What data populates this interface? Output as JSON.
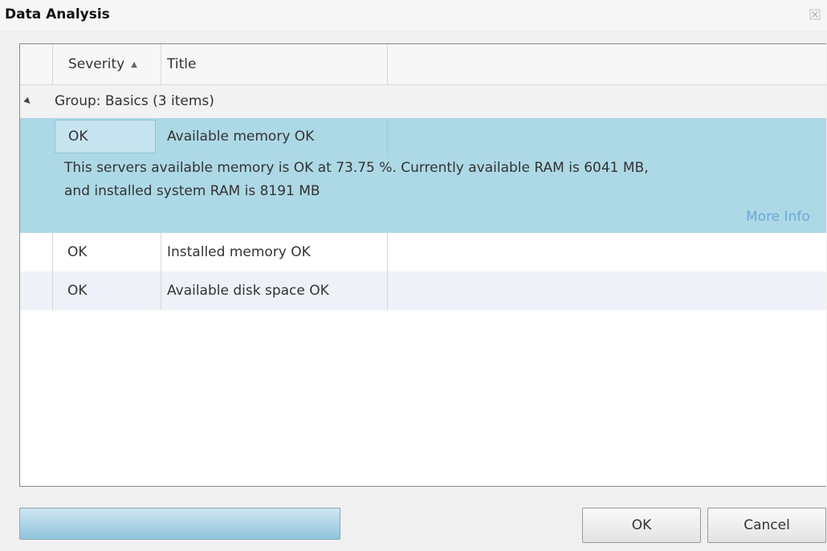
{
  "window": {
    "title": "Data Analysis"
  },
  "grid": {
    "columns": [
      {
        "label": "Severity",
        "sort": "ascending"
      },
      {
        "label": "Title"
      }
    ],
    "group": {
      "label": "Group: Basics (3 items)",
      "expanded": true
    },
    "selected_row": {
      "severity": "OK",
      "title": "Available memory OK",
      "detail_line1": "This servers available memory is OK at 73.75 %. Currently available RAM is 6041 MB,",
      "detail_line2": "and installed system RAM is 8191 MB",
      "more_info_label": "More Info"
    },
    "rows": [
      {
        "severity": "OK",
        "title": "Installed memory OK"
      },
      {
        "severity": "OK",
        "title": "Available disk space OK"
      }
    ]
  },
  "buttons": {
    "ok_label": "OK",
    "cancel_label": "Cancel"
  },
  "colors": {
    "selection": "#add8e6",
    "link": "#6aa8d8",
    "alt_row": "#eef1f7"
  },
  "icons": {
    "close": "close-icon",
    "sort": "sort-ascending-icon",
    "group_toggle": "expand-triangle-icon"
  }
}
